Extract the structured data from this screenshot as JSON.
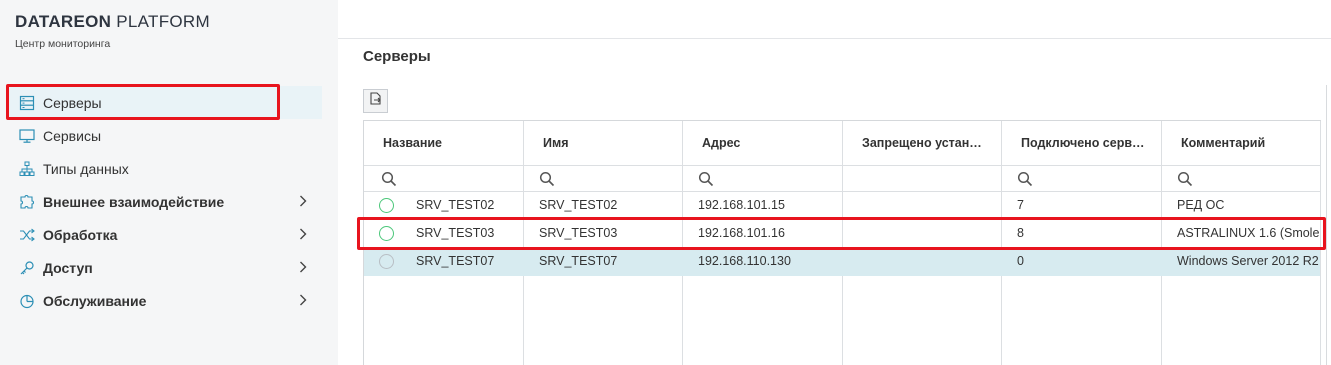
{
  "brand": {
    "title_bold": "DATAREON",
    "title_light": "PLATFORM",
    "subtitle": "Центр мониторинга"
  },
  "sidebar": {
    "items": [
      {
        "label": "Серверы",
        "icon": "server-icon",
        "active": true
      },
      {
        "label": "Сервисы",
        "icon": "monitor-icon"
      },
      {
        "label": "Типы данных",
        "icon": "data-types-icon"
      },
      {
        "label": "Внешнее взаимодействие",
        "icon": "puzzle-icon",
        "expandable": true
      },
      {
        "label": "Обработка",
        "icon": "shuffle-icon",
        "expandable": true
      },
      {
        "label": "Доступ",
        "icon": "key-icon",
        "expandable": true
      },
      {
        "label": "Обслуживание",
        "icon": "pie-chart-icon",
        "expandable": true
      }
    ]
  },
  "main": {
    "title": "Серверы",
    "toolbar": {
      "export_icon": "export-icon"
    },
    "table": {
      "columns": [
        "Название",
        "Имя",
        "Адрес",
        "Запрещено устана…",
        "Подключено серв…",
        "Комментарий"
      ],
      "rows": [
        {
          "status": "online",
          "name": "SRV_TEST02",
          "host": "SRV_TEST02",
          "address": "192.168.101.15",
          "forbidden": "",
          "connected": "7",
          "comment": "РЕД ОС"
        },
        {
          "status": "online",
          "name": "SRV_TEST03",
          "host": "SRV_TEST03",
          "address": "192.168.101.16",
          "forbidden": "",
          "connected": "8",
          "comment": "ASTRALINUX 1.6 (Smole"
        },
        {
          "status": "offline",
          "name": "SRV_TEST07",
          "host": "SRV_TEST07",
          "address": "192.168.110.130",
          "forbidden": "",
          "connected": "0",
          "comment": "Windows Server 2012 R2"
        }
      ]
    }
  },
  "colors": {
    "accent": "#2c8fb5",
    "status_online": "#4cc77a",
    "status_offline": "#b8bec4",
    "highlight": "#e8141e",
    "selected_row": "#d7ebf0"
  }
}
